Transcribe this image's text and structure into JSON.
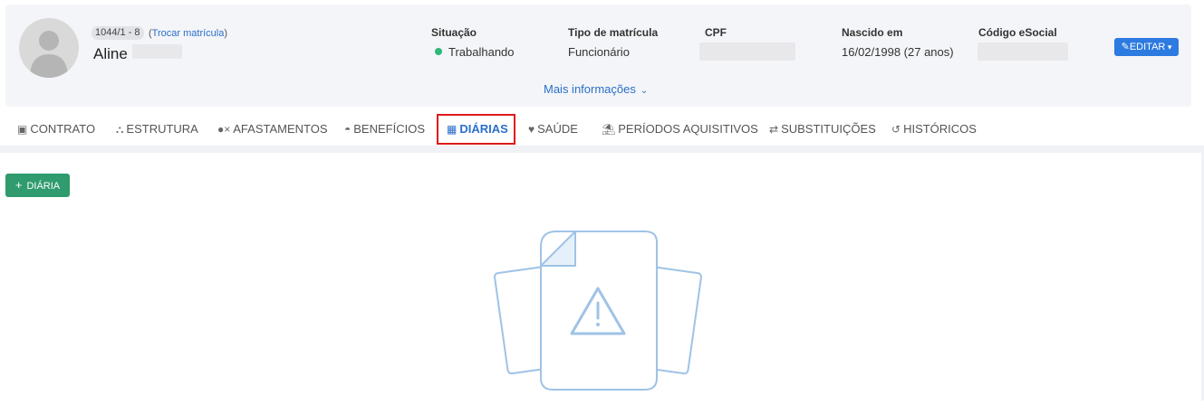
{
  "employee": {
    "registration": "1044/1 - 8",
    "swap_prefix": "(",
    "swap_link": "Trocar matrícula",
    "swap_suffix": ")",
    "first_name": "Aline"
  },
  "fields": {
    "situation_label": "Situação",
    "situation_value": "Trabalhando",
    "enrollment_label": "Tipo de matrícula",
    "enrollment_value": "Funcionário",
    "cpf_label": "CPF",
    "birth_label": "Nascido em",
    "birth_value": "16/02/1998 (27 anos)",
    "esocial_label": "Código eSocial"
  },
  "actions": {
    "edit_label": "EDITAR",
    "more_info_label": "Mais informações",
    "add_label": "DIÁRIA"
  },
  "tabs": [
    {
      "label": "CONTRATO",
      "icon": "id-card-icon"
    },
    {
      "label": "ESTRUTURA",
      "icon": "sitemap-icon"
    },
    {
      "label": "AFASTAMENTOS",
      "icon": "user-x-icon"
    },
    {
      "label": "BENEFÍCIOS",
      "icon": "hand-user-icon"
    },
    {
      "label": "DIÁRIAS",
      "icon": "building-icon",
      "active": true
    },
    {
      "label": "SAÚDE",
      "icon": "heartbeat-icon"
    },
    {
      "label": "PERÍODOS AQUISITIVOS",
      "icon": "beach-umbrella-icon"
    },
    {
      "label": "SUBSTITUIÇÕES",
      "icon": "swap-arrows-icon"
    },
    {
      "label": "HISTÓRICOS",
      "icon": "history-icon"
    }
  ],
  "colors": {
    "accent": "#2a6fc9",
    "success": "#2eb87a",
    "add_button": "#2f9b6e",
    "highlight": "#e01818"
  }
}
